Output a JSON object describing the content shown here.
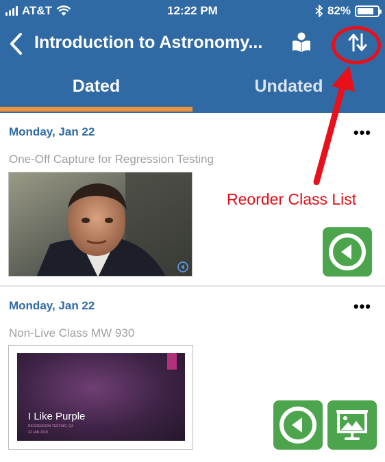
{
  "status_bar": {
    "carrier": "AT&T",
    "time": "12:22 PM",
    "battery": "82%",
    "battery_level": 0.82
  },
  "nav": {
    "title": "Introduction to Astronomy...",
    "icons": [
      "back-chevron-icon",
      "book-reader-icon",
      "sort-arrows-icon"
    ]
  },
  "tabs": [
    {
      "label": "Dated",
      "active": true
    },
    {
      "label": "Undated",
      "active": false
    }
  ],
  "sessions": [
    {
      "date": "Monday, Jan 22",
      "more": "•••",
      "title": "One-Off Capture for Regression Testing",
      "actions": [
        "play"
      ]
    },
    {
      "date": "Monday, Jan 22",
      "more": "•••",
      "title": "Non-Live Class MW 930",
      "actions": [
        "play",
        "presentation"
      ],
      "slide": {
        "title": "I Like Purple",
        "subtitle": "REGRESSION TESTING, Q4",
        "date": "22 JAN 2018"
      }
    }
  ],
  "annotation": {
    "label": "Reorder Class List",
    "color": "#e8101a"
  },
  "colors": {
    "header": "#2f6aa4",
    "tab_indicator": "#f0923a",
    "action_green": "#4ca54c",
    "date_blue": "#2f6aa4"
  }
}
